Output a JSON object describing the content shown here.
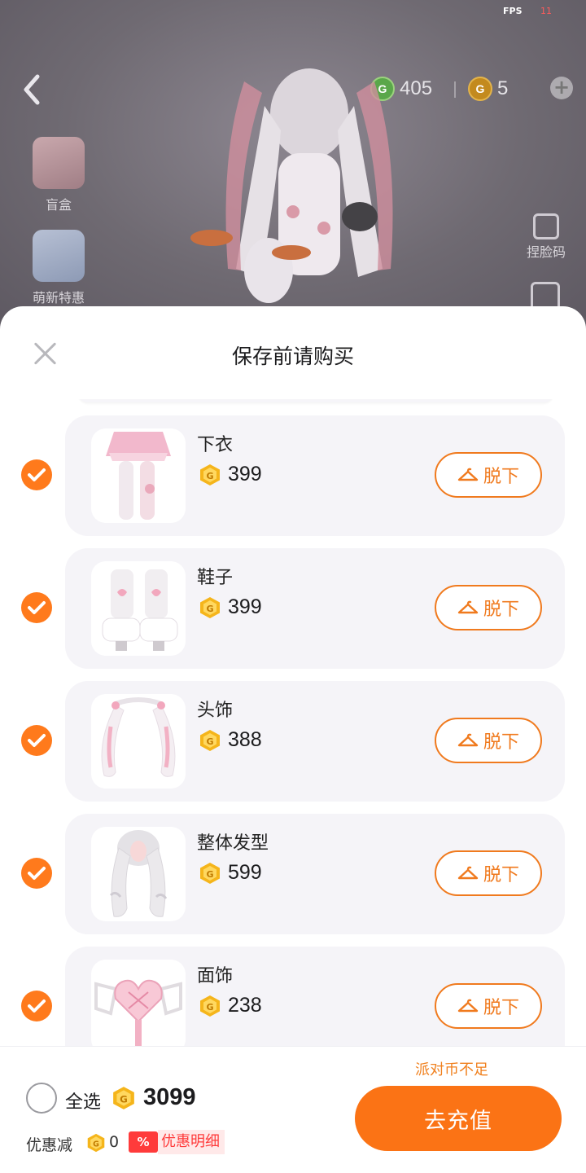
{
  "hud": {
    "fps_label": "FPS",
    "fps_value": "11",
    "g_coins": "405",
    "party_coins": "5",
    "left_menu": [
      {
        "label": "盲盒",
        "icon": "gift-box-icon"
      },
      {
        "label": "萌新特惠",
        "icon": "newbie-deal-icon"
      }
    ],
    "right_menu": [
      {
        "label": "捏脸码",
        "icon": "face-code-icon"
      }
    ]
  },
  "sheet": {
    "title": "保存前请购买",
    "items": [
      {
        "name": "下衣",
        "price": "399",
        "action": "脱下",
        "checked": true,
        "thumb": "skirt-tights"
      },
      {
        "name": "鞋子",
        "price": "399",
        "action": "脱下",
        "checked": true,
        "thumb": "boots"
      },
      {
        "name": "头饰",
        "price": "388",
        "action": "脱下",
        "checked": true,
        "thumb": "bunny-ears"
      },
      {
        "name": "整体发型",
        "price": "599",
        "action": "脱下",
        "checked": true,
        "thumb": "hairstyle"
      },
      {
        "name": "面饰",
        "price": "238",
        "action": "脱下",
        "checked": true,
        "thumb": "heart-mask"
      }
    ]
  },
  "footer": {
    "select_all": "全选",
    "total": "3099",
    "discount_label": "优惠减",
    "discount_value": "0",
    "discount_badge": "%",
    "discount_detail": "优惠明细",
    "insufficient": "派对币不足",
    "recharge": "去充值"
  },
  "colors": {
    "accent": "#fb7315",
    "coin_gold": "#f5b51b",
    "discount_red": "#ff3b3b"
  }
}
